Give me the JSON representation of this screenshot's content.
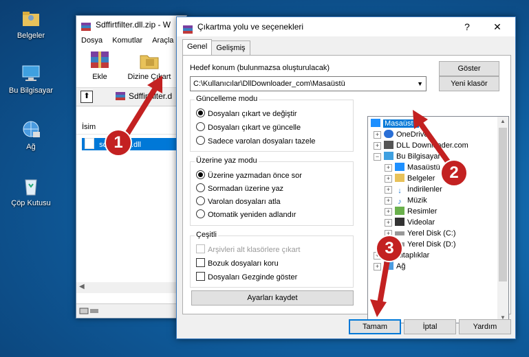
{
  "desktop": {
    "icons": [
      {
        "label": "Belgeler"
      },
      {
        "label": "Bu Bilgisayar"
      },
      {
        "label": "Ağ"
      },
      {
        "label": "Çöp Kutusu"
      }
    ]
  },
  "winrar": {
    "title": "Sdffirtfilter.dll.zip - W",
    "menu": [
      "Dosya",
      "Komutlar",
      "Araçla"
    ],
    "tool_add": "Ekle",
    "tool_extract": "Dizine Çıkart",
    "address": "Sdffirtfilter.d",
    "col_name": "İsim",
    "file": "sdffirtfilter.dll"
  },
  "dialog": {
    "title": "Çıkartma yolu ve seçenekleri",
    "help_btn": "?",
    "close_btn": "✕",
    "tabs": [
      "Genel",
      "Gelişmiş"
    ],
    "dest_label": "Hedef konum (bulunmazsa oluşturulacak)",
    "dest_value": "C:\\Kullanıcılar\\DllDownloader_com\\Masaüstü",
    "show_btn": "Göster",
    "new_folder_btn": "Yeni klasör",
    "update_mode": {
      "caption": "Güncelleme modu",
      "options": [
        "Dosyaları çıkart ve değiştir",
        "Dosyaları çıkart ve güncelle",
        "Sadece varolan dosyaları tazele"
      ],
      "selected": 0
    },
    "overwrite_mode": {
      "caption": "Üzerine yaz modu",
      "options": [
        "Üzerine yazmadan önce sor",
        "Sormadan üzerine yaz",
        "Varolan dosyaları atla",
        "Otomatik yeniden adlandır"
      ],
      "selected": 0
    },
    "misc": {
      "caption": "Çeşitli",
      "options": [
        "Arşivleri alt klasörlere çıkart",
        "Bozuk dosyaları koru",
        "Dosyaları Gezginde göster"
      ]
    },
    "save_settings_btn": "Ayarları kaydet",
    "tree": [
      {
        "label": "Masaüstü",
        "level": 0,
        "selected": true
      },
      {
        "label": "OneDrive",
        "level": 1
      },
      {
        "label": "DLL Downloader.com",
        "level": 1
      },
      {
        "label": "Bu Bilgisayar",
        "level": 1
      },
      {
        "label": "Masaüstü",
        "level": 2
      },
      {
        "label": "Belgeler",
        "level": 2
      },
      {
        "label": "İndirilenler",
        "level": 2
      },
      {
        "label": "Müzik",
        "level": 2
      },
      {
        "label": "Resimler",
        "level": 2
      },
      {
        "label": "Videolar",
        "level": 2
      },
      {
        "label": "Yerel Disk (C:)",
        "level": 2
      },
      {
        "label": "Yerel Disk (D:)",
        "level": 2
      },
      {
        "label": "Kitaplıklar",
        "level": 1
      },
      {
        "label": "Ağ",
        "level": 1
      }
    ],
    "ok_btn": "Tamam",
    "cancel_btn": "İptal",
    "help_text_btn": "Yardım"
  },
  "callouts": [
    "1",
    "2",
    "3"
  ],
  "colors": {
    "callout": "#c32121",
    "selection": "#0078d7"
  }
}
